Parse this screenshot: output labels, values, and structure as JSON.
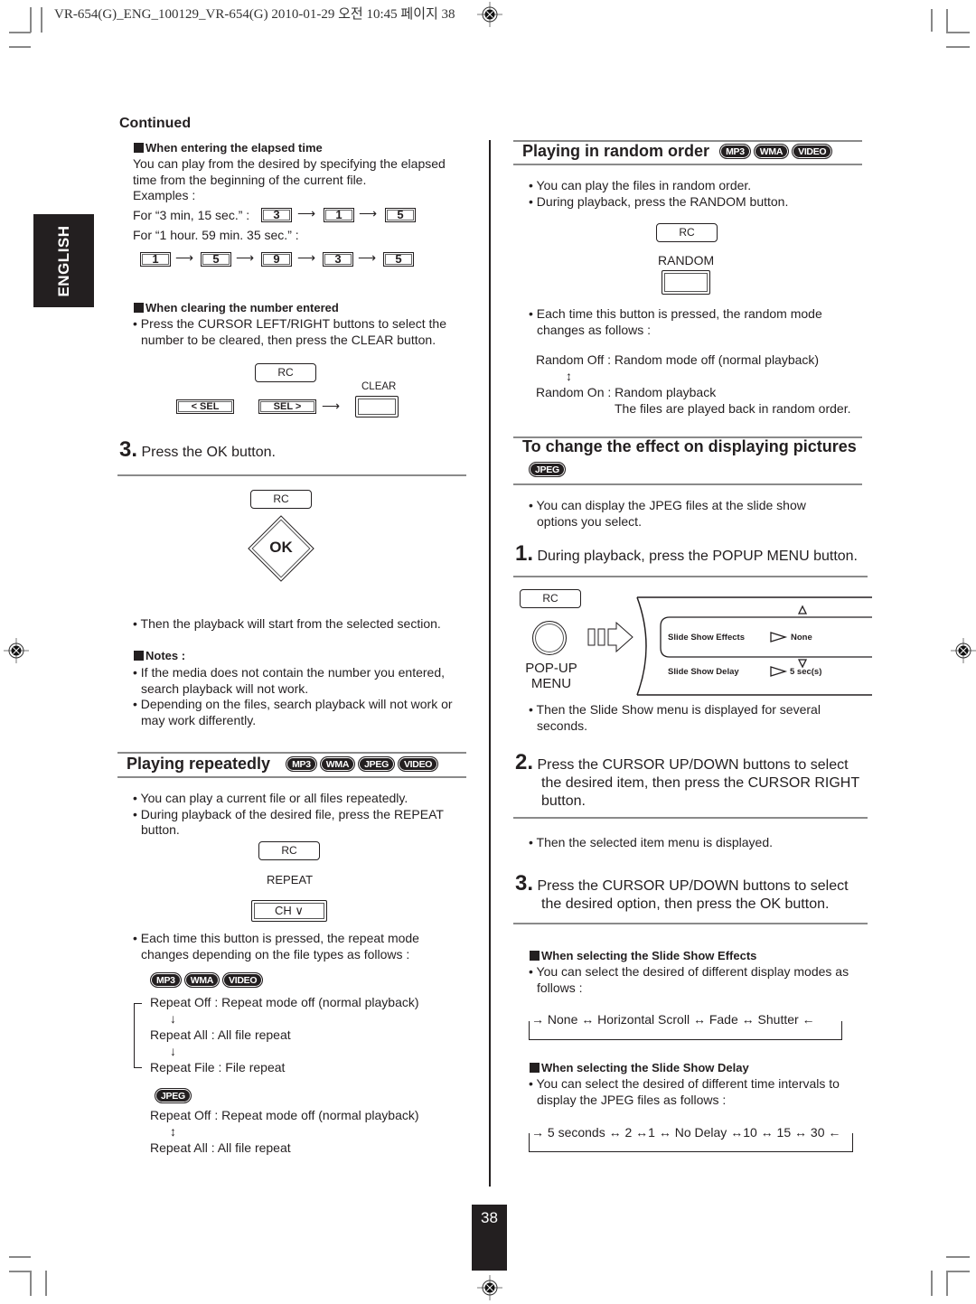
{
  "header": {
    "print_info": "VR-654(G)_ENG_100129_VR-654(G)  2010-01-29  오전 10:45  페이지 38"
  },
  "language_tab": "ENGLISH",
  "page_number": "38",
  "left": {
    "continued": "Continued",
    "elapsed": {
      "heading": "When entering the elapsed time",
      "text1": "You can play from the desired by specifying the elapsed",
      "text2": "time from the beginning of the current file.",
      "examples": "Examples :",
      "ex1_label": "For “3 min, 15 sec.” :",
      "ex1_keys": [
        "3",
        "1",
        "5"
      ],
      "ex2_label": "For “1 hour. 59 min. 35 sec.” :",
      "ex2_keys": [
        "1",
        "5",
        "9",
        "3",
        "5"
      ]
    },
    "clearing": {
      "heading": "When clearing the number entered",
      "line1": "• Press the CURSOR LEFT/RIGHT buttons to select the",
      "line2": "number to be cleared, then press the CLEAR button.",
      "rc": "RC",
      "clear_label": "CLEAR",
      "sel_left": "< SEL",
      "sel_right": "SEL >"
    },
    "step3": {
      "num": "3.",
      "text": "Press the OK button.",
      "rc": "RC",
      "ok": "OK"
    },
    "then_text": "• Then the playback will start from the selected section.",
    "notes": {
      "heading": "Notes :",
      "n1a": "• If the media does not contain the number you entered,",
      "n1b": "search playback will not work.",
      "n2a": "• Depending on the files, search playback will not work or",
      "n2b": "may work differently."
    },
    "repeat": {
      "title": "Playing repeatedly",
      "badges": [
        "MP3",
        "WMA",
        "JPEG",
        "VIDEO"
      ],
      "b1": "• You can play a current file or all files repeatedly.",
      "b2a": "• During playback of the desired file, press the REPEAT",
      "b2b": "button.",
      "rc": "RC",
      "repeat_label": "REPEAT",
      "ch_button": "CH ∨",
      "b3a": "• Each time this button is pressed, the repeat mode",
      "b3b": "changes depending on the file types as follows :",
      "group1_badges": [
        "MP3",
        "WMA",
        "VIDEO"
      ],
      "g1_off": "Repeat Off : Repeat mode off (normal playback)",
      "g1_all": "Repeat All : All file repeat",
      "g1_file": "Repeat File : File repeat",
      "down_arrow": "↓",
      "group2_badge": "JPEG",
      "g2_off": "Repeat Off : Repeat mode off (normal playback)",
      "updown": "↕",
      "g2_all": "Repeat All : All file repeat"
    }
  },
  "right": {
    "random": {
      "title": "Playing in random order",
      "badges": [
        "MP3",
        "WMA",
        "VIDEO"
      ],
      "b1": "• You can play the files in random order.",
      "b2": "• During playback, press the RANDOM button.",
      "rc": "RC",
      "random_label": "RANDOM",
      "b3a": "• Each time this button is pressed, the random mode",
      "b3b": "changes as follows :",
      "off": "Random Off : Random mode off (normal playback)",
      "updown": "↕",
      "on": "Random On : Random playback",
      "on_desc": "The files are played back in random order."
    },
    "effect": {
      "title": "To change the effect on displaying pictures",
      "badge": "JPEG",
      "b1a": "• You can display the JPEG files at the slide show",
      "b1b": "options you select.",
      "step1_num": "1.",
      "step1": "During playback, press the POPUP MENU button.",
      "rc": "RC",
      "popup1": "POP-UP",
      "popup2": "MENU",
      "menu": {
        "row1_label": "Slide Show Effects",
        "row1_value": "None",
        "row2_label": "Slide Show Delay",
        "row2_value": "5 sec(s)"
      },
      "then1a": "• Then the Slide Show menu is displayed for several",
      "then1b": "seconds.",
      "step2_num": "2.",
      "step2a": "Press the CURSOR UP/DOWN buttons to select",
      "step2b": "the desired item, then press the CURSOR RIGHT",
      "step2c": "button.",
      "then2": "• Then the selected item menu is displayed.",
      "step3_num": "3.",
      "step3a": "Press the CURSOR UP/DOWN buttons to select",
      "step3b": "the desired option, then press the OK button.",
      "effects_heading": "When selecting the Slide Show Effects",
      "effects_a": "• You can select the desired of different display modes as",
      "effects_b": "follows :",
      "effects_flow": "→  None  ↔  Horizontal Scroll  ↔  Fade  ↔  Shutter  ←",
      "delay_heading": "When selecting the Slide Show Delay",
      "delay_a": "• You can select the desired of different time intervals to",
      "delay_b": "display the JPEG files as follows :",
      "delay_flow": "→ 5 seconds ↔  2 ↔1 ↔  No Delay ↔10 ↔  15 ↔ 30  ←"
    }
  }
}
